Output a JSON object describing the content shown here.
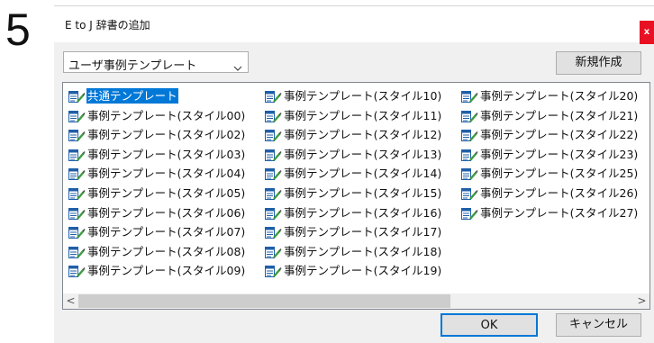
{
  "step_number": "5",
  "dialog": {
    "title": "E to J 辞書の追加",
    "close_label": "x"
  },
  "template_select": {
    "value": "ユーザ事例テンプレート",
    "icon": "chevron-down-icon"
  },
  "new_button_label": "新規作成",
  "list": {
    "item_icon": "dictionary-edit-icon",
    "selected_index": 0,
    "columns": [
      [
        "共通テンプレート",
        "事例テンプレート(スタイル00)",
        "事例テンプレート(スタイル02)",
        "事例テンプレート(スタイル03)",
        "事例テンプレート(スタイル04)",
        "事例テンプレート(スタイル05)",
        "事例テンプレート(スタイル06)",
        "事例テンプレート(スタイル07)",
        "事例テンプレート(スタイル08)",
        "事例テンプレート(スタイル09)"
      ],
      [
        "事例テンプレート(スタイル10)",
        "事例テンプレート(スタイル11)",
        "事例テンプレート(スタイル12)",
        "事例テンプレート(スタイル13)",
        "事例テンプレート(スタイル14)",
        "事例テンプレート(スタイル15)",
        "事例テンプレート(スタイル16)",
        "事例テンプレート(スタイル17)",
        "事例テンプレート(スタイル18)",
        "事例テンプレート(スタイル19)"
      ],
      [
        "事例テンプレート(スタイル20)",
        "事例テンプレート(スタイル21)",
        "事例テンプレート(スタイル22)",
        "事例テンプレート(スタイル23)",
        "事例テンプレート(スタイル25)",
        "事例テンプレート(スタイル26)",
        "事例テンプレート(スタイル27)"
      ]
    ]
  },
  "scrollbar": {
    "left_arrow": "<",
    "right_arrow": ">",
    "thumb_fraction": 0.67
  },
  "ok_label": "OK",
  "cancel_label": "キャンセル",
  "colors": {
    "accent": "#0078d7",
    "close": "#e81123"
  }
}
